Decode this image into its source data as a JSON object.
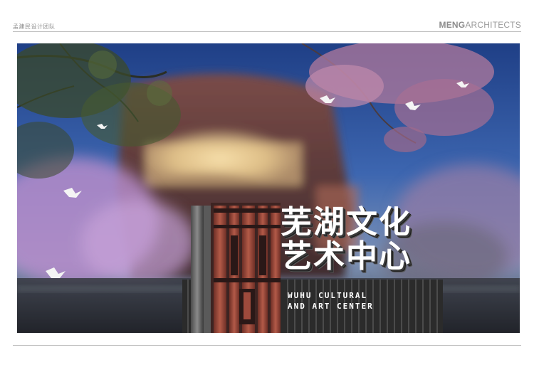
{
  "header": {
    "team_label": "孟建民设计团队",
    "brand_bold": "MENG",
    "brand_light": "ARCHITECTS"
  },
  "sign": {
    "title_cn_line1": "芜湖文化",
    "title_cn_line2": "艺术中心",
    "title_en_line1": "WUHU CULTURAL",
    "title_en_line2": "AND ART CENTER"
  },
  "colors": {
    "sky_top": "#1f3f86",
    "sky_mid": "#3d66b0",
    "blossom": "#c8a0d6",
    "building_copper": "#8a4a3a",
    "building_glow": "#f3d79a",
    "sign_red": "#9e4a3c",
    "sign_dark": "#2e2e2e"
  }
}
